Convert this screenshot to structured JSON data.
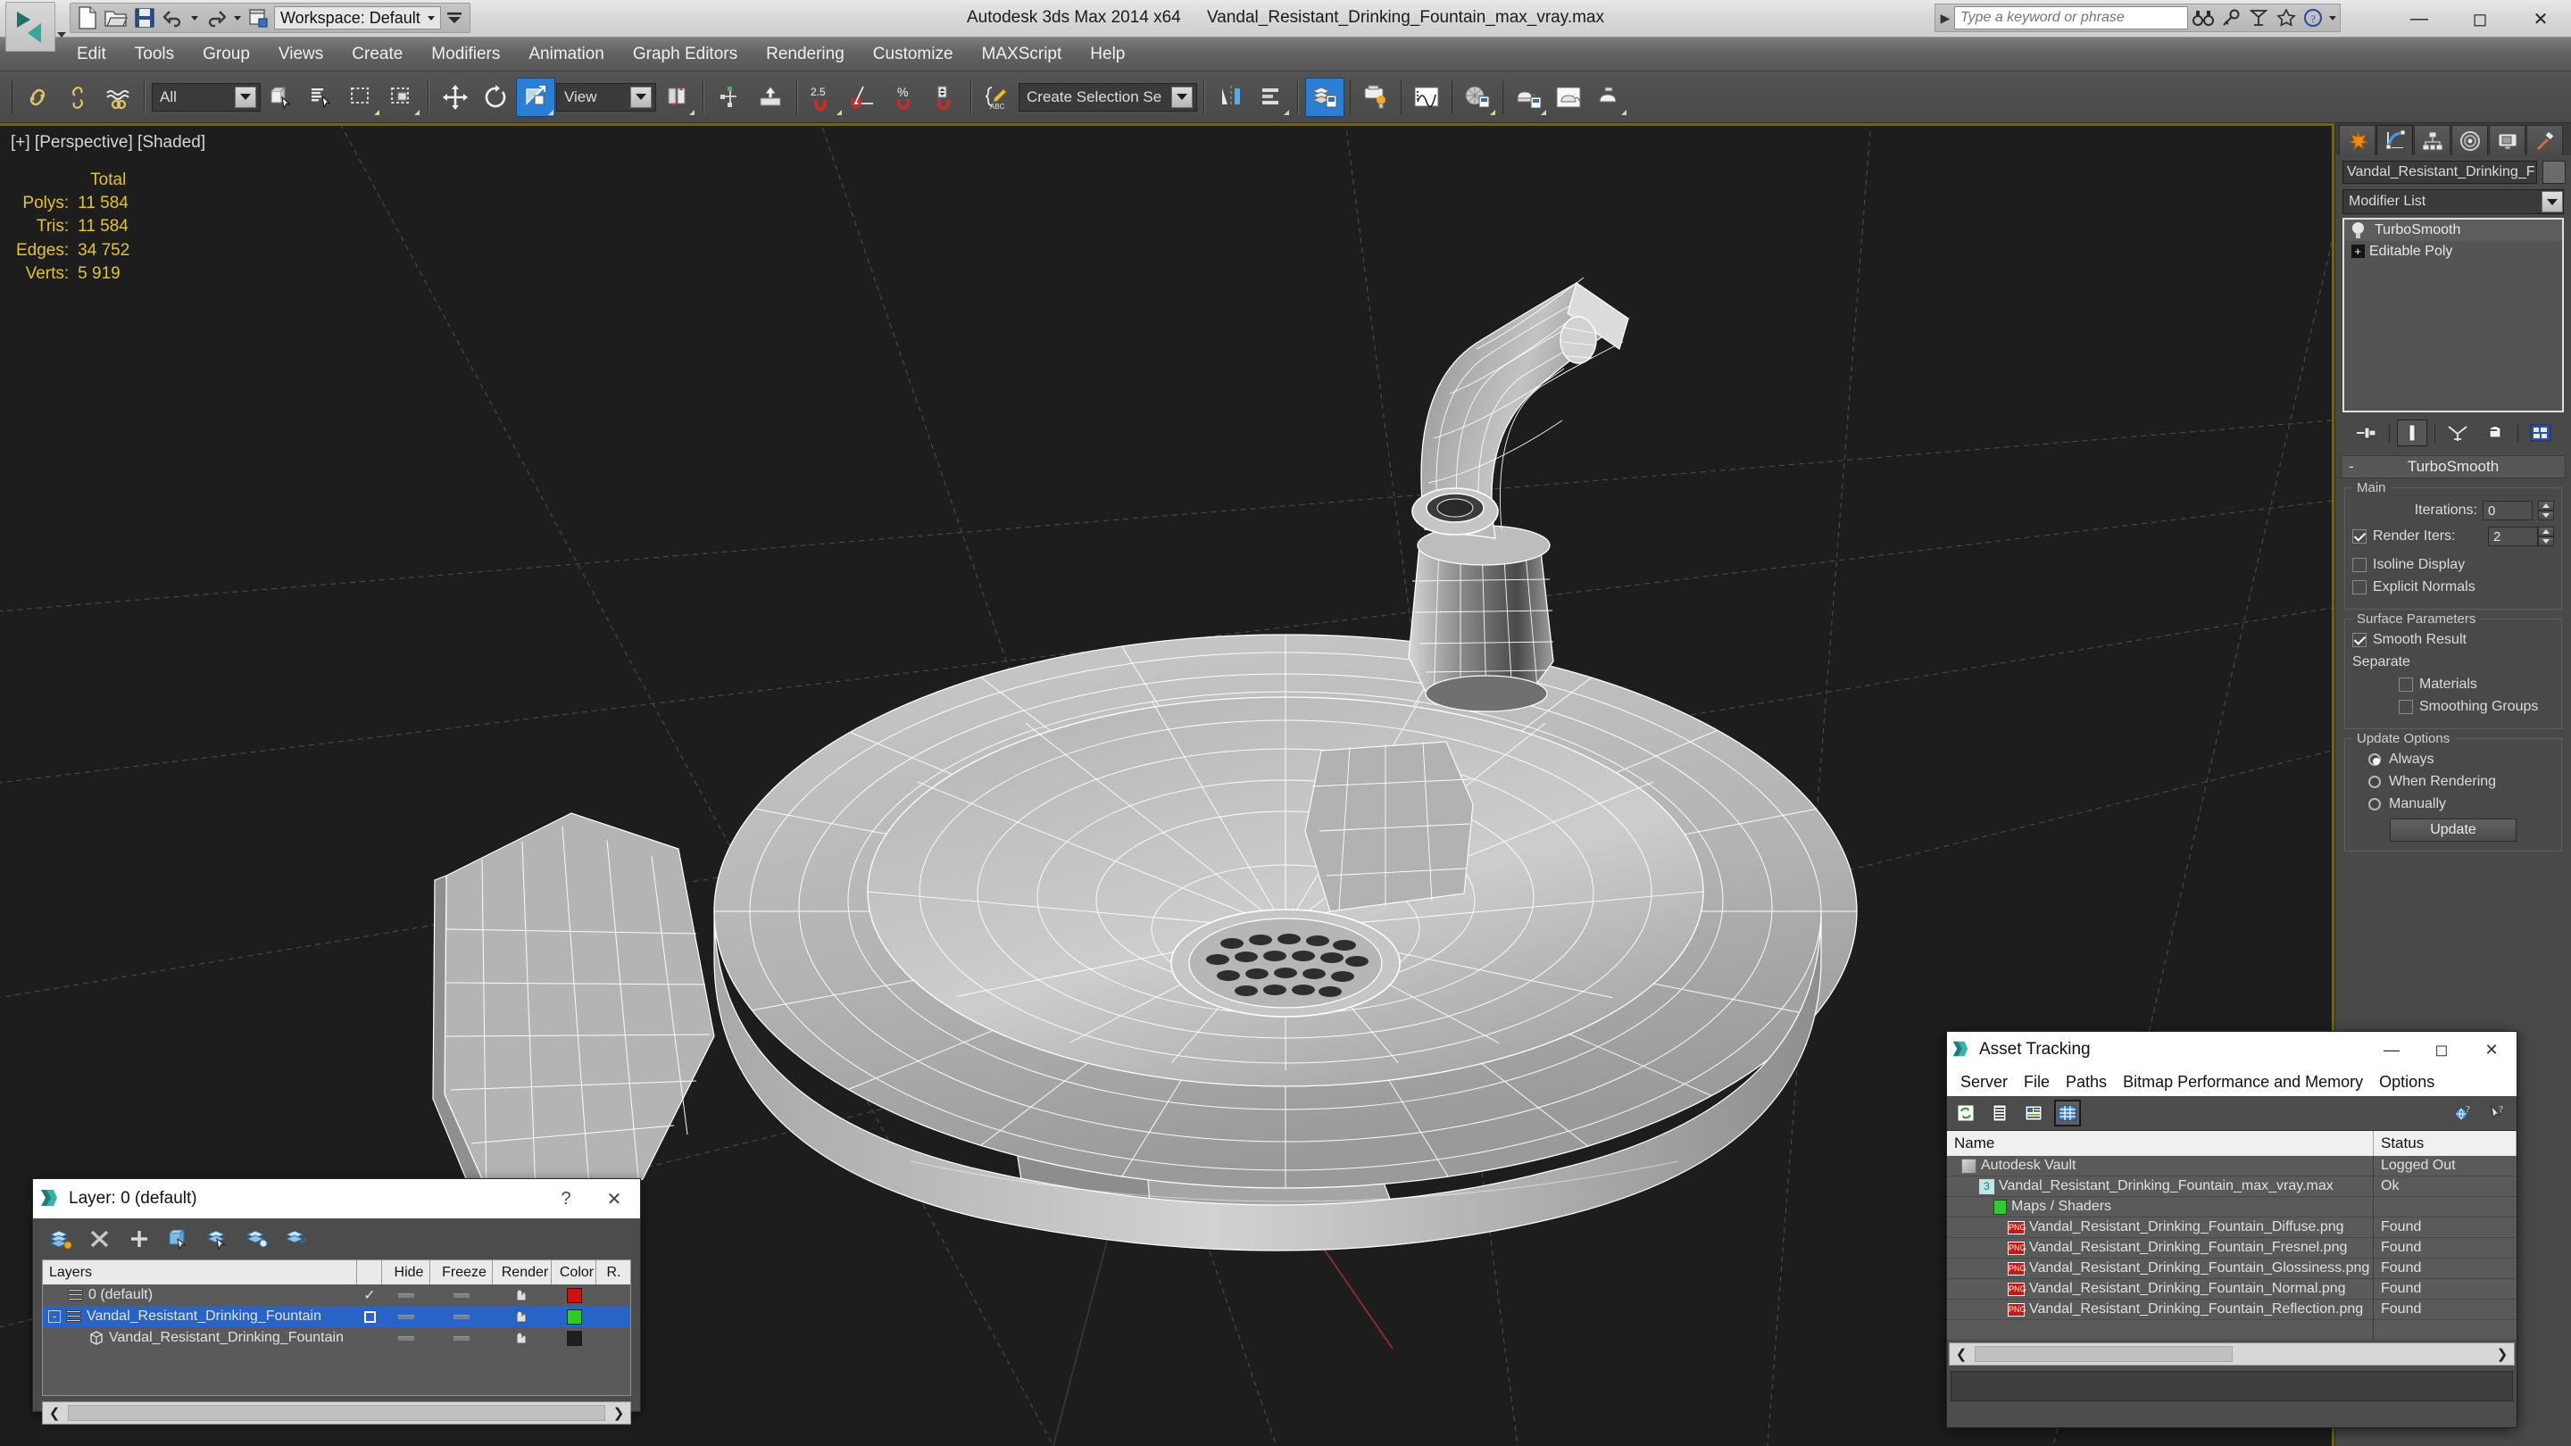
{
  "titlebar": {
    "app_title": "Autodesk 3ds Max  2014 x64",
    "file_name": "Vandal_Resistant_Drinking_Fountain_max_vray.max",
    "workspace_label": "Workspace: Default",
    "search_placeholder": "Type a keyword or phrase",
    "quick_access": [
      {
        "name": "new-file-icon",
        "label": "New"
      },
      {
        "name": "open-file-icon",
        "label": "Open"
      },
      {
        "name": "save-file-icon",
        "label": "Save"
      },
      {
        "name": "undo-icon",
        "label": "Undo"
      },
      {
        "name": "redo-icon",
        "label": "Redo"
      },
      {
        "name": "project-folder-icon",
        "label": "Set Project Folder"
      }
    ],
    "search_buttons": [
      "binoculars-icon",
      "key-icon",
      "subscription-icon",
      "favorites-star-icon",
      "help-question-icon"
    ],
    "window_controls": [
      "minimize",
      "maximize",
      "close"
    ]
  },
  "menubar": {
    "items": [
      "Edit",
      "Tools",
      "Group",
      "Views",
      "Create",
      "Modifiers",
      "Animation",
      "Graph Editors",
      "Rendering",
      "Customize",
      "MAXScript",
      "Help"
    ]
  },
  "toolbar": {
    "selection_filter": "All",
    "reference_coordinate": "View",
    "named_selection_sets": "Create Selection Se",
    "snap_angle": "2.5",
    "buttons": [
      "select-link-icon",
      "unlink-selection-icon",
      "bind-to-space-warp-icon",
      "select-object-icon",
      "select-by-name-icon",
      "rectangular-selection-region-icon",
      "window-crossing-icon",
      "select-and-move-icon",
      "select-and-rotate-icon",
      "select-and-uniform-scale-icon",
      "use-pivot-point-center-icon",
      "select-and-manipulate-icon",
      "snaps-toggle-icon",
      "angle-snap-toggle-icon",
      "percent-snap-toggle-icon",
      "spinner-snap-toggle-icon",
      "edit-named-selection-sets-icon",
      "mirror-icon",
      "align-icon",
      "layer-explorer-icon",
      "toggle-scene-explorer-icon",
      "render-setup-icon",
      "curve-editor-icon",
      "schematic-view-icon",
      "material-editor-icon",
      "render-production-icon",
      "rendered-frame-window-icon"
    ]
  },
  "viewport": {
    "label": "[+] [Perspective] [Shaded]",
    "stats_header": "Total",
    "stats": [
      {
        "label": "Polys:",
        "value": "11 584"
      },
      {
        "label": "Tris:",
        "value": "11 584"
      },
      {
        "label": "Edges:",
        "value": "34 752"
      },
      {
        "label": "Verts:",
        "value": "5 919"
      }
    ],
    "stats_color": "#e4c325",
    "background_color": "#1d1d1d",
    "grid_color": "#5a5a5a",
    "border_color": "#6e6324"
  },
  "command_panel": {
    "tabs": [
      {
        "name": "create-tab",
        "icon": "star-burst-icon",
        "active": false
      },
      {
        "name": "modify-tab",
        "icon": "curve-arc-icon",
        "active": true
      },
      {
        "name": "hierarchy-tab",
        "icon": "hierarchy-icon",
        "active": false
      },
      {
        "name": "motion-tab",
        "icon": "motion-wheel-icon",
        "active": false
      },
      {
        "name": "display-tab",
        "icon": "display-monitor-icon",
        "active": false
      },
      {
        "name": "utilities-tab",
        "icon": "hammer-icon",
        "active": false
      }
    ],
    "object_name": "Vandal_Resistant_Drinking_F",
    "modifier_list_label": "Modifier List",
    "modifier_stack": [
      {
        "label": "TurboSmooth",
        "selected": true,
        "icon": "light-bulb-icon"
      },
      {
        "label": "Editable Poly",
        "selected": false,
        "icon": "plus-box-icon"
      }
    ],
    "stack_tools": [
      "pin-stack-icon",
      "show-end-result-icon",
      "make-unique-icon",
      "remove-modifier-icon",
      "configure-modifier-sets-icon"
    ],
    "rollout": {
      "title": "TurboSmooth",
      "main_group": "Main",
      "iterations_label": "Iterations:",
      "iterations_value": "0",
      "render_iters_label": "Render Iters:",
      "render_iters_value": "2",
      "render_iters_checked": true,
      "isoline_display_label": "Isoline Display",
      "isoline_display_checked": false,
      "explicit_normals_label": "Explicit Normals",
      "explicit_normals_checked": false,
      "surface_group": "Surface Parameters",
      "smooth_result_label": "Smooth Result",
      "smooth_result_checked": true,
      "separate_label": "Separate",
      "materials_label": "Materials",
      "materials_checked": false,
      "smoothing_groups_label": "Smoothing Groups",
      "smoothing_groups_checked": false,
      "update_group": "Update Options",
      "update_options": [
        {
          "label": "Always",
          "selected": true
        },
        {
          "label": "When Rendering",
          "selected": false
        },
        {
          "label": "Manually",
          "selected": false
        }
      ],
      "update_button": "Update"
    }
  },
  "layer_dialog": {
    "title": "Layer: 0 (default)",
    "help_label": "?",
    "close_label": "✕",
    "tools": [
      "create-new-layer-icon",
      "delete-layer-icon",
      "add-selection-to-layer-icon",
      "select-objects-in-layer-icon",
      "select-highlighted-objects-icon",
      "highlight-selected-objects-layer-icon",
      "hide-unhide-layer-icon"
    ],
    "columns": [
      "Layers",
      "",
      "Hide",
      "Freeze",
      "Render",
      "Color",
      "R."
    ],
    "rows": [
      {
        "name": "0 (default)",
        "indent": 0,
        "selected": false,
        "current": true,
        "color": "#cc1111",
        "expander": ""
      },
      {
        "name": "Vandal_Resistant_Drinking_Fountain",
        "indent": 0,
        "selected": true,
        "current": false,
        "color": "#2fcc22",
        "expander": "-"
      },
      {
        "name": "Vandal_Resistant_Drinking_Fountain",
        "indent": 1,
        "selected": false,
        "current": false,
        "color": "#1e1e1e",
        "expander": ""
      }
    ]
  },
  "asset_tracking": {
    "title": "Asset Tracking",
    "menu": [
      "Server",
      "File",
      "Paths",
      "Bitmap Performance and Memory",
      "Options"
    ],
    "toolbar_icons": [
      {
        "name": "refresh-icon",
        "selected": false
      },
      {
        "name": "list-view-icon",
        "selected": false
      },
      {
        "name": "details-view-icon",
        "selected": false
      },
      {
        "name": "grid-view-icon",
        "selected": true
      }
    ],
    "right_icons": [
      "help-globe-icon",
      "help-pointer-icon"
    ],
    "columns": [
      "Name",
      "Status"
    ],
    "rows": [
      {
        "name": "Autodesk Vault",
        "status": "Logged Out",
        "indent": 0,
        "icon": "vault-icon"
      },
      {
        "name": "Vandal_Resistant_Drinking_Fountain_max_vray.max",
        "status": "Ok",
        "indent": 1,
        "icon": "max-file-icon"
      },
      {
        "name": "Maps / Shaders",
        "status": "",
        "indent": 2,
        "icon": "maps-shaders-icon"
      },
      {
        "name": "Vandal_Resistant_Drinking_Fountain_Diffuse.png",
        "status": "Found",
        "indent": 3,
        "icon": "png-icon"
      },
      {
        "name": "Vandal_Resistant_Drinking_Fountain_Fresnel.png",
        "status": "Found",
        "indent": 3,
        "icon": "png-icon"
      },
      {
        "name": "Vandal_Resistant_Drinking_Fountain_Glossiness.png",
        "status": "Found",
        "indent": 3,
        "icon": "png-icon"
      },
      {
        "name": "Vandal_Resistant_Drinking_Fountain_Normal.png",
        "status": "Found",
        "indent": 3,
        "icon": "png-icon"
      },
      {
        "name": "Vandal_Resistant_Drinking_Fountain_Reflection.png",
        "status": "Found",
        "indent": 3,
        "icon": "png-icon"
      }
    ]
  }
}
